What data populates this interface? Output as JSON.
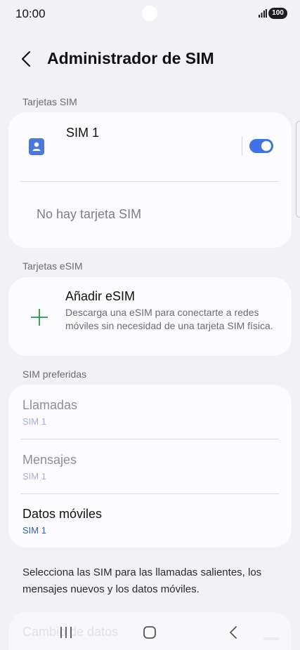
{
  "status_bar": {
    "time": "10:00",
    "battery": "100",
    "icons": [
      "signal-icon",
      "battery-icon"
    ]
  },
  "header": {
    "title": "Administrador de SIM",
    "back_icon": "back-icon"
  },
  "sim_section": {
    "label": "Tarjetas SIM",
    "sim1_name": "SIM 1",
    "sim1_enabled": true,
    "no_sim_text": "No hay tarjeta SIM"
  },
  "esim_section": {
    "label": "Tarjetas eSIM",
    "add_title": "Añadir eSIM",
    "add_description": "Descarga una eSIM para conectarte a redes móviles sin necesidad de una tarjeta SIM física."
  },
  "preferred_section": {
    "label": "SIM preferidas",
    "items": [
      {
        "title": "Llamadas",
        "value": "SIM 1"
      },
      {
        "title": "Mensajes",
        "value": "SIM 1"
      },
      {
        "title": "Datos móviles",
        "value": "SIM 1"
      }
    ]
  },
  "footer_note": "Selecciona las SIM para las llamadas salientes, los mensajes nuevos y los datos móviles.",
  "next_item_partial": "Cambio de datos",
  "colors": {
    "background": "#f2f2f6",
    "card": "#fcfcfe",
    "toggle_on": "#3e72e6",
    "sim_icon": "#4a78e0",
    "plus_icon": "#3aa45c",
    "link_value": "#2f5fb8"
  },
  "nav_bar": {
    "icons": [
      "recents-icon",
      "home-icon",
      "back-icon"
    ]
  }
}
